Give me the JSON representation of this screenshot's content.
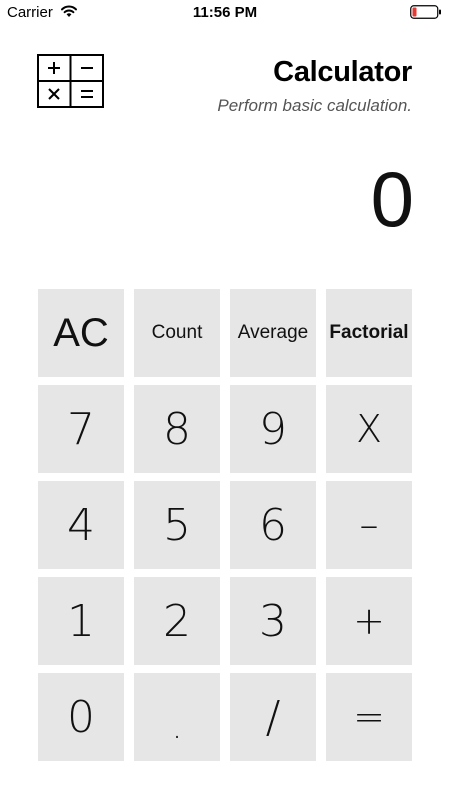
{
  "status_bar": {
    "carrier": "Carrier",
    "time": "11:56 PM"
  },
  "header": {
    "title": "Calculator",
    "subtitle": "Perform basic calculation."
  },
  "display": {
    "value": "0"
  },
  "keypad": {
    "ac": "AC",
    "count": "Count",
    "average": "Average",
    "factorial": "Factorial",
    "seven": "7",
    "eight": "8",
    "nine": "9",
    "multiply": "X",
    "four": "4",
    "five": "5",
    "six": "6",
    "minus": "–",
    "one": "1",
    "two": "2",
    "three": "3",
    "plus": "+",
    "zero": "0",
    "dot": ".",
    "divide": "/",
    "equals": "="
  },
  "colors": {
    "key_background": "#e6e6e6",
    "background": "#ffffff",
    "battery_low": "#e53935"
  },
  "icons": [
    "wifi-icon",
    "battery-icon",
    "calculator-logo-icon"
  ]
}
